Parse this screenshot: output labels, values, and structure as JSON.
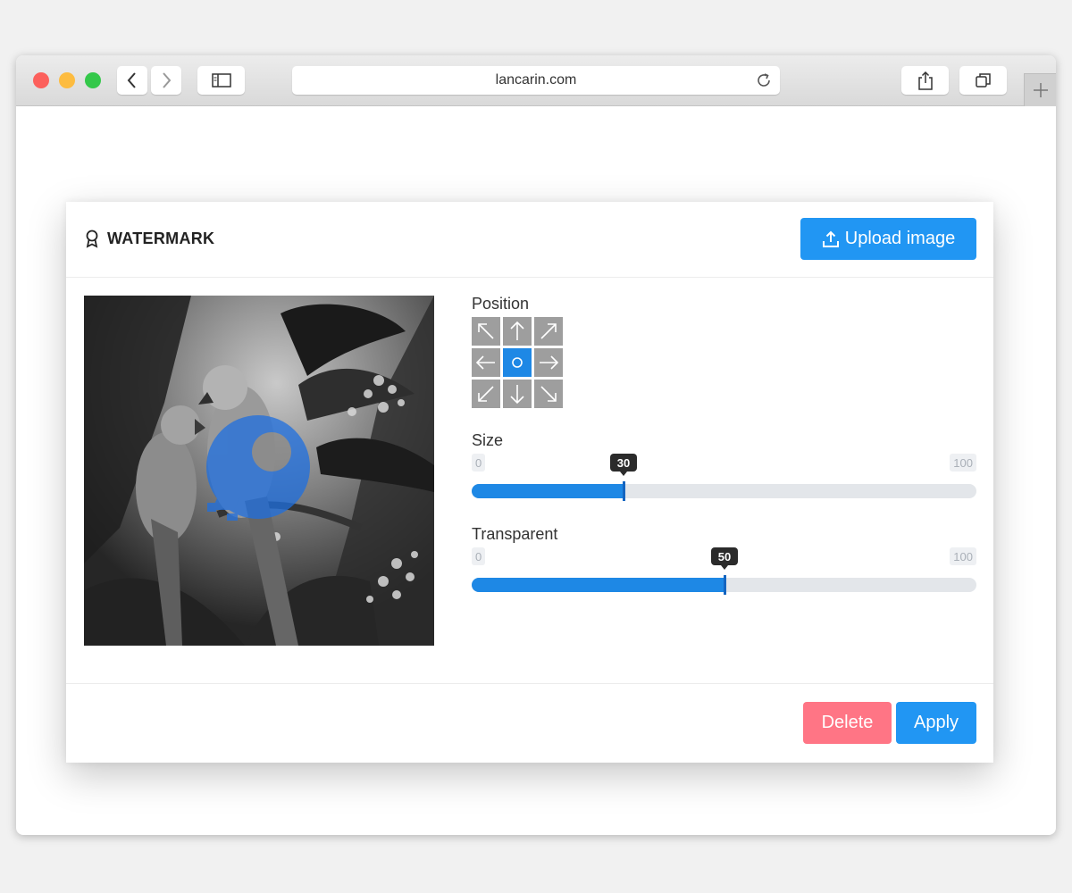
{
  "browser": {
    "url": "lancarin.com",
    "back_icon": "chevron-left-icon",
    "forward_icon": "chevron-right-icon",
    "sidebar_icon": "sidebar-icon",
    "reload_icon": "reload-icon",
    "share_icon": "share-icon",
    "tabs_icon": "tabs-icon",
    "new_tab_icon": "plus-icon"
  },
  "modal": {
    "title": "WATERMARK",
    "title_icon": "award-icon",
    "upload_label": "Upload image",
    "upload_icon": "upload-icon",
    "image_icon": "watermark-logo-icon",
    "position": {
      "label": "Position",
      "cells": [
        "up-left-arrow-icon",
        "up-arrow-icon",
        "up-right-arrow-icon",
        "left-arrow-icon",
        "center-circle-icon",
        "right-arrow-icon",
        "down-left-arrow-icon",
        "down-arrow-icon",
        "down-right-arrow-icon"
      ],
      "selected": 4
    },
    "size": {
      "label": "Size",
      "min": "0",
      "max": "100",
      "value": "30"
    },
    "transparent": {
      "label": "Transparent",
      "min": "0",
      "max": "100",
      "value": "50"
    },
    "delete_label": "Delete",
    "apply_label": "Apply"
  },
  "colors": {
    "accent": "#2196f3",
    "delete": "#ff7585",
    "grid_cell": "#9e9e9e",
    "slider_fill": "#1e88e5"
  }
}
